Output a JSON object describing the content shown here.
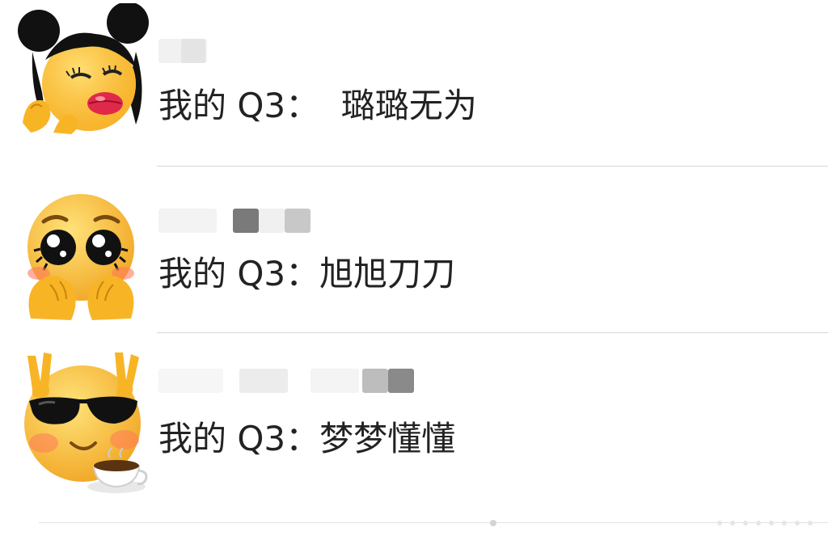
{
  "comments": [
    {
      "avatar_icon": "kiss-lips-emoji-with-buns-icon",
      "nickname": "",
      "text": "我的 Q3：  璐璐无为"
    },
    {
      "avatar_icon": "pleading-face-with-hands-icon",
      "nickname": "",
      "text": "我的 Q3：旭旭刀刀"
    },
    {
      "avatar_icon": "sunglasses-peace-coffee-emoji-icon",
      "nickname": "",
      "text": "我的 Q3：梦梦懂懂"
    }
  ],
  "colors": {
    "text": "#222222",
    "divider": "#d6d6d6",
    "emoji_yellow": "#ffc83a",
    "blush": "#ff7a5a"
  }
}
